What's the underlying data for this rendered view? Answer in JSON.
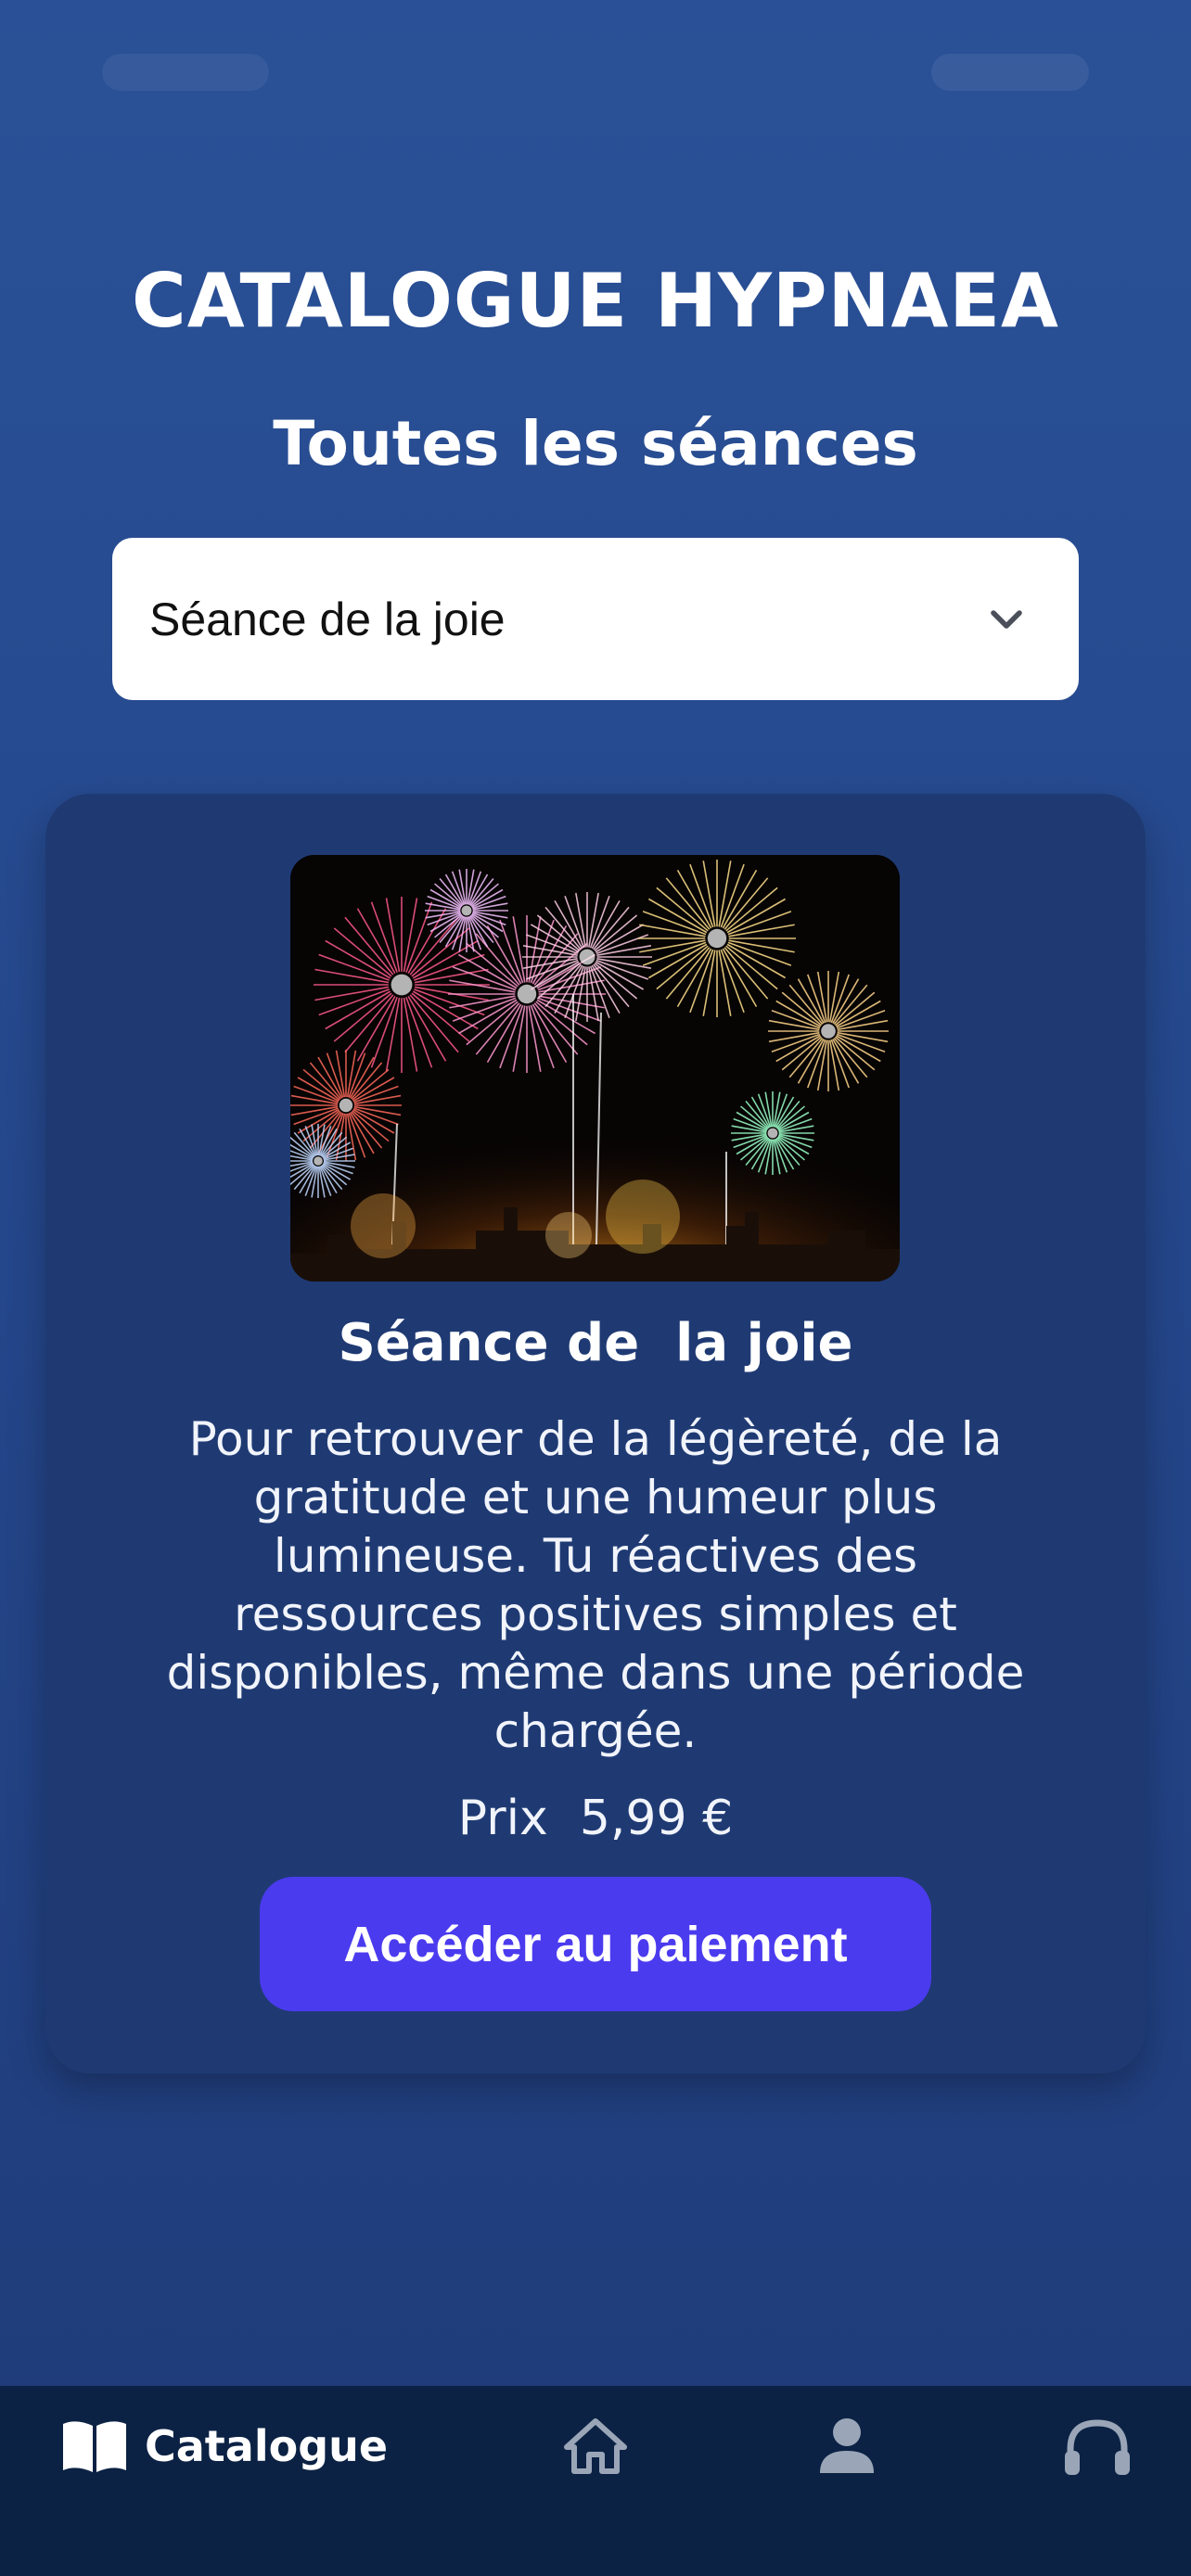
{
  "header": {
    "app_title": "CATALOGUE HYPNAEA",
    "section_title": "Toutes les séances"
  },
  "filter": {
    "selected": "Séance de la joie",
    "icon": "chevron-down-icon"
  },
  "session": {
    "image_icon": "fireworks-image",
    "title": "Séance de  la joie",
    "description": "Pour retrouver de la légèreté, de la gratitude et une humeur plus lumineuse. Tu réactives des ressources positives simples et disponibles, même dans une période chargée.",
    "price_label": "Prix",
    "price_value": "5,99 €",
    "pay_button_label": "Accéder au paiement"
  },
  "bottom_nav": {
    "items": [
      {
        "label": "Catalogue",
        "icon": "book-open-icon",
        "active": true
      },
      {
        "label": "",
        "icon": "home-icon",
        "active": false
      },
      {
        "label": "",
        "icon": "user-icon",
        "active": false
      },
      {
        "label": "",
        "icon": "headphones-icon",
        "active": false
      }
    ]
  },
  "colors": {
    "background_top": "#2a5197",
    "card": "#1f3a73",
    "button": "#4b3bef",
    "nav": "#0b2244",
    "nav_icon_inactive": "#9aa6b8"
  }
}
